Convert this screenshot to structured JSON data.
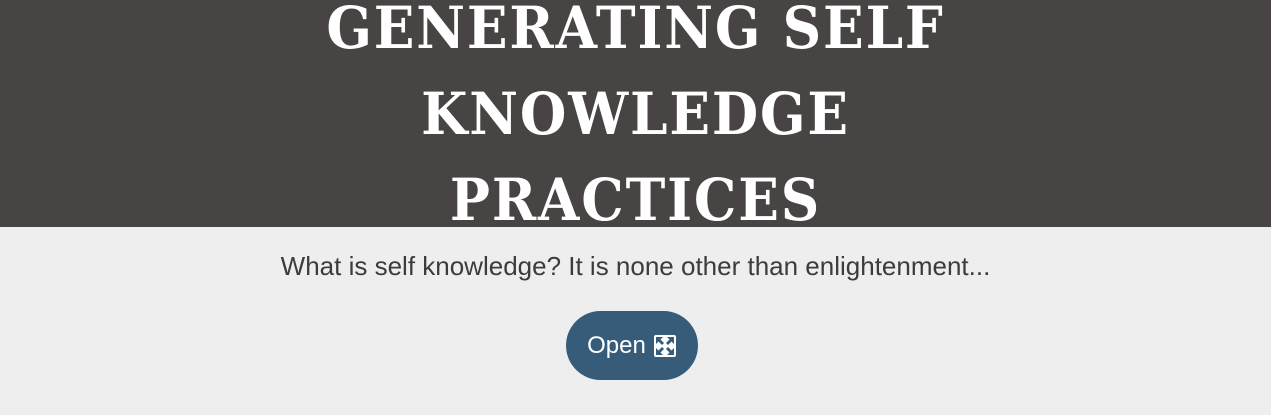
{
  "header": {
    "title_line1": "GENERATING SELF KNOWLEDGE",
    "title_line2": "PRACTICES"
  },
  "main": {
    "subtitle": "What is self knowledge? It is none other than enlightenment...",
    "open_button": {
      "label": "Open",
      "icon": "expand-icon"
    }
  },
  "colors": {
    "header_background": "#484443",
    "page_background": "#eeeeee",
    "button_background": "#365c7a",
    "title_text": "#ffffff",
    "body_text": "#3c3c3c"
  }
}
